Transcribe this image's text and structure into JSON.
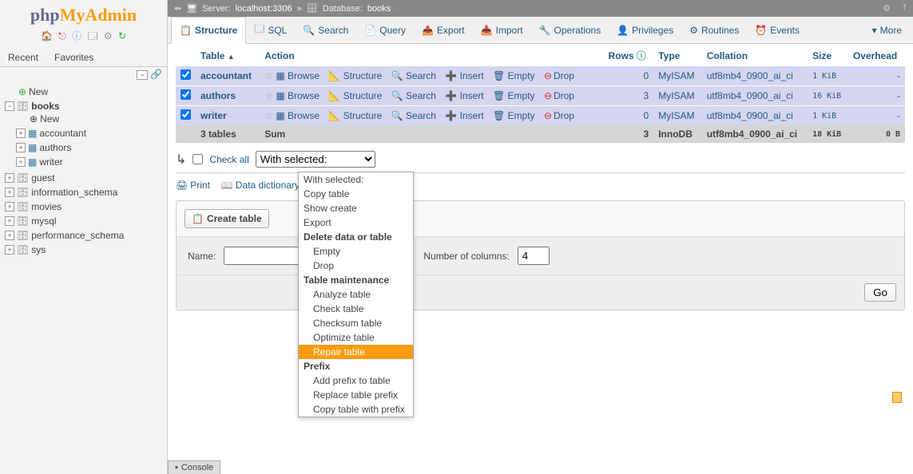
{
  "logo": {
    "php": "php",
    "my": "My",
    "admin": "Admin"
  },
  "sidebar_tabs": {
    "recent": "Recent",
    "favorites": "Favorites"
  },
  "tree": {
    "new": "New",
    "current_db": "books",
    "db_children": [
      {
        "label": "New"
      },
      {
        "label": "accountant"
      },
      {
        "label": "authors"
      },
      {
        "label": "writer"
      }
    ],
    "other_dbs": [
      "guest",
      "information_schema",
      "movies",
      "mysql",
      "performance_schema",
      "sys"
    ]
  },
  "breadcrumb": {
    "server_label": "Server:",
    "server": "localhost:3306",
    "sep": "»",
    "db_label": "Database:",
    "db": "books"
  },
  "main_tabs": [
    {
      "icon": "📋",
      "label": "Structure",
      "active": true
    },
    {
      "icon": "🗔",
      "label": "SQL"
    },
    {
      "icon": "🔍",
      "label": "Search"
    },
    {
      "icon": "📄",
      "label": "Query"
    },
    {
      "icon": "📤",
      "label": "Export"
    },
    {
      "icon": "📥",
      "label": "Import"
    },
    {
      "icon": "🔧",
      "label": "Operations"
    },
    {
      "icon": "👤",
      "label": "Privileges"
    },
    {
      "icon": "⚙",
      "label": "Routines"
    },
    {
      "icon": "⏰",
      "label": "Events"
    }
  ],
  "more_label": "More",
  "table_headers": {
    "table": "Table",
    "action": "Action",
    "rows": "Rows",
    "type": "Type",
    "collation": "Collation",
    "size": "Size",
    "overhead": "Overhead"
  },
  "action_labels": {
    "browse": "Browse",
    "structure": "Structure",
    "search": "Search",
    "insert": "Insert",
    "empty": "Empty",
    "drop": "Drop"
  },
  "tables": [
    {
      "name": "accountant",
      "rows": "0",
      "type": "MyISAM",
      "collation": "utf8mb4_0900_ai_ci",
      "size": "1 KiB",
      "overhead": "-"
    },
    {
      "name": "authors",
      "rows": "3",
      "type": "MyISAM",
      "collation": "utf8mb4_0900_ai_ci",
      "size": "16 KiB",
      "overhead": "-"
    },
    {
      "name": "writer",
      "rows": "0",
      "type": "MyISAM",
      "collation": "utf8mb4_0900_ai_ci",
      "size": "1 KiB",
      "overhead": "-"
    }
  ],
  "summary": {
    "count": "3 tables",
    "sum": "Sum",
    "rows": "3",
    "type": "InnoDB",
    "collation": "utf8mb4_0900_ai_ci",
    "size": "18 KiB",
    "overhead": "0 B"
  },
  "checkall": {
    "label": "Check all",
    "select_label": "With selected:"
  },
  "print_row": {
    "print": "Print",
    "dict": "Data dictionary"
  },
  "create": {
    "btn": "Create table",
    "name_label": "Name:",
    "name_value": "",
    "cols_label": "Number of columns:",
    "cols_value": "4",
    "go": "Go"
  },
  "dropdown": [
    {
      "text": "With selected:",
      "type": "normal"
    },
    {
      "text": "Copy table",
      "type": "normal"
    },
    {
      "text": "Show create",
      "type": "normal"
    },
    {
      "text": "Export",
      "type": "normal"
    },
    {
      "text": "Delete data or table",
      "type": "group"
    },
    {
      "text": "Empty",
      "type": "indent"
    },
    {
      "text": "Drop",
      "type": "indent"
    },
    {
      "text": "Table maintenance",
      "type": "group"
    },
    {
      "text": "Analyze table",
      "type": "indent"
    },
    {
      "text": "Check table",
      "type": "indent"
    },
    {
      "text": "Checksum table",
      "type": "indent"
    },
    {
      "text": "Optimize table",
      "type": "indent"
    },
    {
      "text": "Repair table",
      "type": "highlight"
    },
    {
      "text": "Prefix",
      "type": "group"
    },
    {
      "text": "Add prefix to table",
      "type": "indent"
    },
    {
      "text": "Replace table prefix",
      "type": "indent"
    },
    {
      "text": "Copy table with prefix",
      "type": "indent"
    }
  ],
  "console": "Console"
}
